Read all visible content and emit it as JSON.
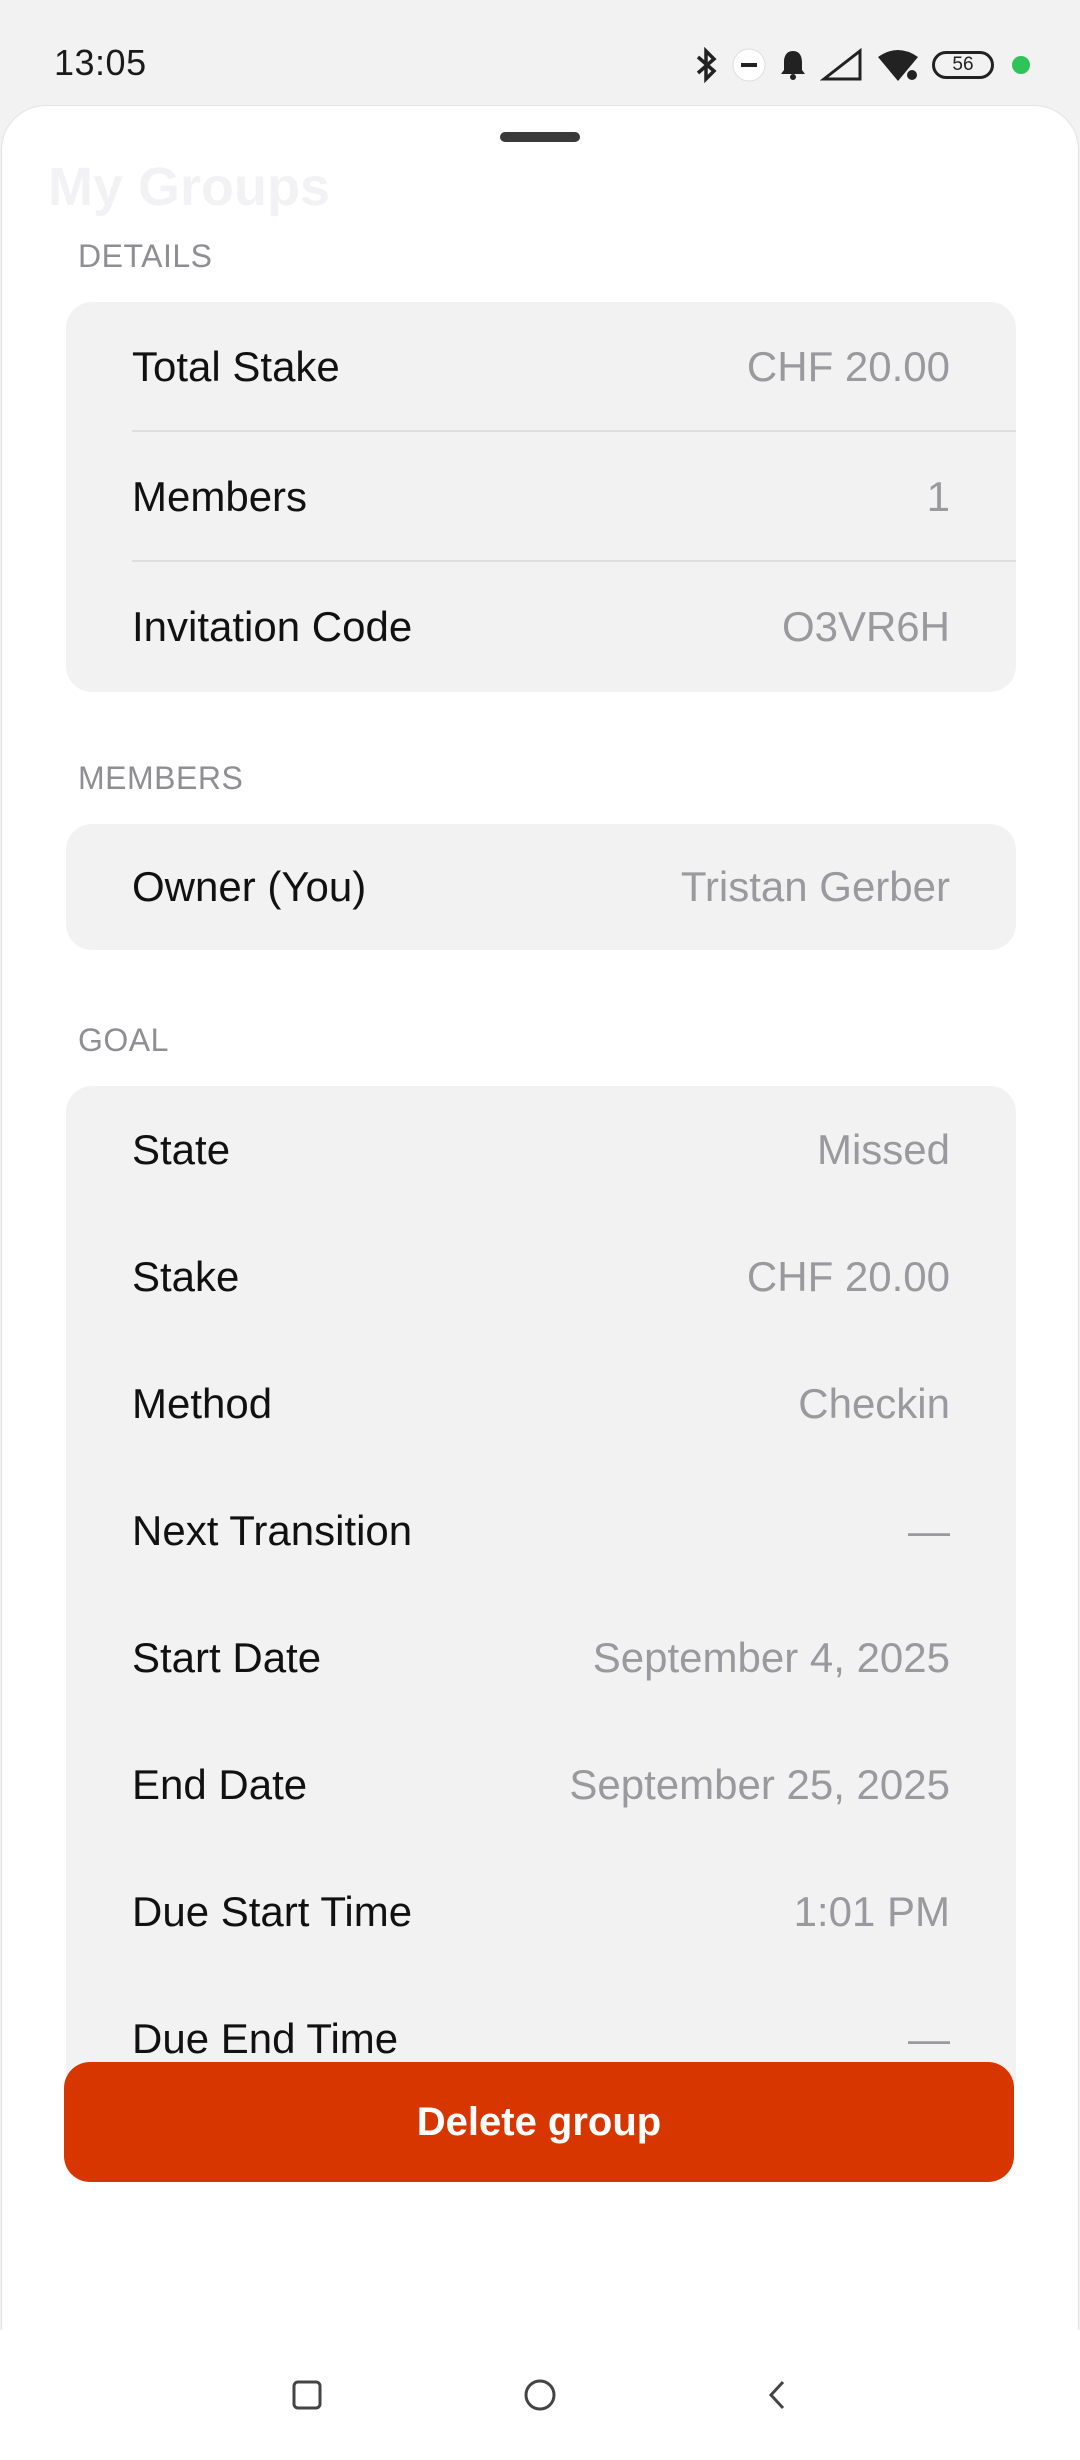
{
  "status_bar": {
    "time": "13:05",
    "battery": "56",
    "icons": [
      "bluetooth-icon",
      "dnd-icon",
      "bell-icon",
      "signal-icon",
      "wifi-icon",
      "battery-icon",
      "green-dot-icon"
    ],
    "accent": "#2ec45a"
  },
  "sheet": {
    "ghost_title": "My Groups"
  },
  "details": {
    "label": "DETAILS",
    "rows": [
      {
        "label": "Total Stake",
        "value": "CHF 20.00"
      },
      {
        "label": "Members",
        "value": "1"
      },
      {
        "label": "Invitation Code",
        "value": "O3VR6H"
      }
    ]
  },
  "members": {
    "label": "MEMBERS",
    "rows": [
      {
        "label": "Owner (You)",
        "value": "Tristan Gerber"
      }
    ]
  },
  "goal": {
    "label": "GOAL",
    "rows": [
      {
        "label": "State",
        "value": "Missed"
      },
      {
        "label": "Stake",
        "value": "CHF 20.00"
      },
      {
        "label": "Method",
        "value": "Checkin"
      },
      {
        "label": "Next Transition",
        "value": "—"
      },
      {
        "label": "Start Date",
        "value": "September 4, 2025"
      },
      {
        "label": "End Date",
        "value": "September 25, 2025"
      },
      {
        "label": "Due Start Time",
        "value": "1:01 PM"
      },
      {
        "label": "Due End Time",
        "value": "—"
      }
    ]
  },
  "actions": {
    "delete_label": "Delete group",
    "delete_color": "#d83600"
  },
  "navbar": {
    "icons": [
      "recents-square-icon",
      "home-circle-icon",
      "back-chevron-icon"
    ]
  }
}
